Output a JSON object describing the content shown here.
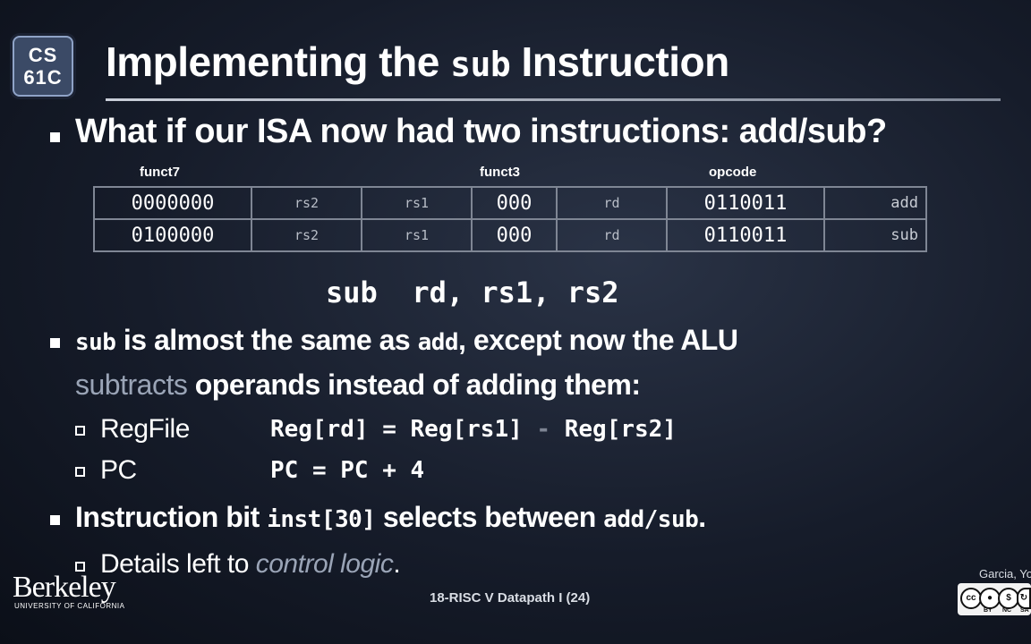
{
  "logo": {
    "line1": "CS",
    "line2": "61C"
  },
  "title": {
    "pre": "Implementing the ",
    "code": "sub",
    "post": " Instruction"
  },
  "bullet1": {
    "text": "What if our ISA now had two instructions: add/sub?"
  },
  "table": {
    "headers": {
      "funct7": "funct7",
      "funct3": "funct3",
      "opcode": "opcode"
    },
    "rows": [
      {
        "funct7": "0000000",
        "rs2": "rs2",
        "rs1": "rs1",
        "funct3": "000",
        "rd": "rd",
        "opcode": "0110011",
        "name": "add"
      },
      {
        "funct7": "0100000",
        "rs2": "rs2",
        "rs1": "rs1",
        "funct3": "000",
        "rd": "rd",
        "opcode": "0110011",
        "name": "sub"
      }
    ]
  },
  "assembly": "sub  rd, rs1, rs2",
  "bullet2": {
    "code1": "sub",
    "text1": " is almost the same as ",
    "code2": "add",
    "text2": ", except now the ALU",
    "highlight": "subtracts",
    "text3": " operands instead of adding them:"
  },
  "subitems": [
    {
      "label": "RegFile",
      "lhs": "Reg[rd] = Reg[rs1] ",
      "op": "-",
      "rhs": " Reg[rs2]"
    },
    {
      "label": "PC",
      "lhs": "PC = PC + 4",
      "op": "",
      "rhs": ""
    }
  ],
  "bullet3": {
    "text1": "Instruction bit ",
    "code1": "inst[30]",
    "text2": " selects between ",
    "code2": "add/sub",
    "text3": "."
  },
  "detail": {
    "text": "Details left to ",
    "italic": "control logic",
    "end": "."
  },
  "branding": {
    "university": "Berkeley",
    "university_sub": "UNIVERSITY OF CALIFORNIA",
    "footer": "18-RISC V Datapath I (24)",
    "author": "Garcia, Yo",
    "license_icons": [
      "cc",
      "by",
      "nc",
      "sa"
    ],
    "license_labels": [
      "BY",
      "NC",
      "SA"
    ]
  }
}
